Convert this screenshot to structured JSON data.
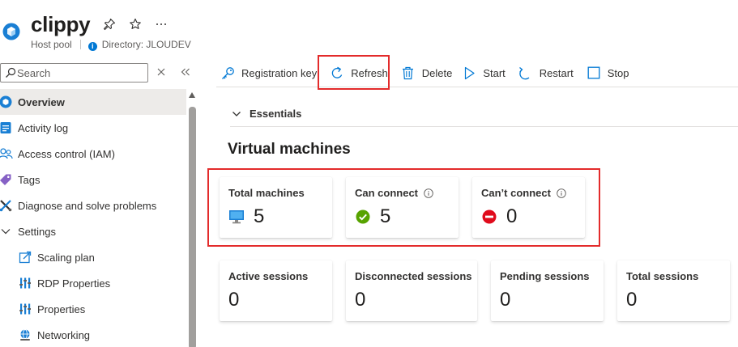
{
  "header": {
    "title": "clippy",
    "resource_type": "Host pool",
    "directory": "Directory: JLOUDEV",
    "pin_icon": "pin-icon",
    "favorite_icon": "star-icon",
    "more_icon": "more-icon"
  },
  "sidebar": {
    "search": {
      "placeholder": "Search",
      "value": ""
    },
    "clear_icon": "close-icon",
    "collapse_icon": "collapse-left-icon",
    "items": [
      {
        "label": "Overview",
        "icon": "overview-icon",
        "selected": true
      },
      {
        "label": "Activity log",
        "icon": "activity-log-icon"
      },
      {
        "label": "Access control (IAM)",
        "icon": "people-icon"
      },
      {
        "label": "Tags",
        "icon": "tag-icon"
      },
      {
        "label": "Diagnose and solve problems",
        "icon": "wrench-icon"
      },
      {
        "label": "Settings",
        "icon": "chevron-down-icon",
        "expanded": true
      },
      {
        "label": "Scaling plan",
        "icon": "scaling-plan-icon",
        "indent": 1
      },
      {
        "label": "RDP Properties",
        "icon": "properties-icon",
        "indent": 1
      },
      {
        "label": "Properties",
        "icon": "properties-icon",
        "indent": 1
      },
      {
        "label": "Networking",
        "icon": "networking-icon",
        "indent": 1
      }
    ]
  },
  "toolbar": {
    "registration_key": "Registration key",
    "refresh": "Refresh",
    "delete": "Delete",
    "start": "Start",
    "restart": "Restart",
    "stop": "Stop"
  },
  "essentials": {
    "label": "Essentials",
    "expanded": false
  },
  "virtual_machines": {
    "title": "Virtual machines",
    "cards": [
      {
        "label": "Total machines",
        "value": "5",
        "icon": "monitor-icon"
      },
      {
        "label": "Can connect",
        "value": "5",
        "icon": "check-circle-icon",
        "info_icon": "info-icon"
      },
      {
        "label": "Can’t connect",
        "value": "0",
        "icon": "block-icon",
        "info_icon": "info-icon"
      }
    ]
  },
  "sessions": {
    "cards": [
      {
        "label": "Active sessions",
        "value": "0"
      },
      {
        "label": "Disconnected sessions",
        "value": "0"
      },
      {
        "label": "Pending sessions",
        "value": "0"
      },
      {
        "label": "Total sessions",
        "value": "0"
      }
    ]
  },
  "colors": {
    "accent": "#0078d4",
    "highlight_box": "#e32b2b",
    "success": "#107c10",
    "error": "#c50f1f",
    "selected_nav": "#edebe9"
  }
}
